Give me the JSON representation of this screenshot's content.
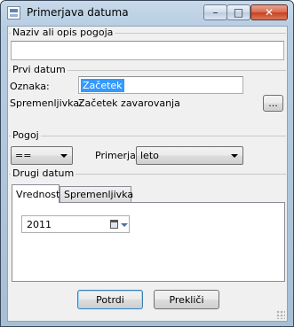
{
  "window": {
    "title": "Primerjava datuma",
    "minimize_label": "–",
    "maximize_label": "□",
    "close_label": "✕"
  },
  "description_group": {
    "label": "Naziv ali opis pogoja",
    "value": ""
  },
  "first_date": {
    "group_label": "Prvi datum",
    "name_label": "Oznaka:",
    "name_value": "Začetek",
    "variable_label": "Spremenljivka:",
    "variable_value": "Začetek zavarovanja",
    "browse_label": "..."
  },
  "condition": {
    "group_label": "Pogoj",
    "operator_value": "==",
    "compare_label": "Primerjaj:",
    "compare_value": "leto"
  },
  "second_date": {
    "group_label": "Drugi datum",
    "tabs": [
      {
        "label": "Vrednost"
      },
      {
        "label": "Spremenljivka"
      }
    ],
    "date_value": "2011"
  },
  "buttons": {
    "confirm_label": "Potrdi",
    "cancel_label": "Prekliči"
  }
}
